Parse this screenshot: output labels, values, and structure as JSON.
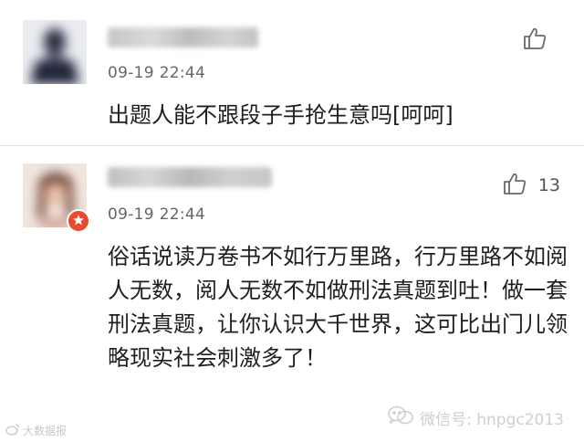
{
  "comments": [
    {
      "timestamp": "09-19 22:44",
      "text": "出题人能不跟段子手抢生意吗[呵呵]",
      "like_count": ""
    },
    {
      "timestamp": "09-19 22:44",
      "text": "俗话说读万卷书不如行万里路，行万里路不如阅人无数，阅人无数不如做刑法真题到吐！做一套刑法真题，让你认识大千世界，这可比出门儿领略现实社会刺激多了！",
      "like_count": "13"
    }
  ],
  "watermark": {
    "text": "微信号: hnpgc2013"
  },
  "corner_mark": {
    "text": "大数据报"
  },
  "icons": {
    "like": "thumbs-up-icon",
    "verified": "star-badge-icon",
    "watermark": "wechat-icon",
    "corner": "weibo-icon"
  },
  "colors": {
    "badge": "#e74a2e",
    "divider": "#e2e2e2"
  }
}
